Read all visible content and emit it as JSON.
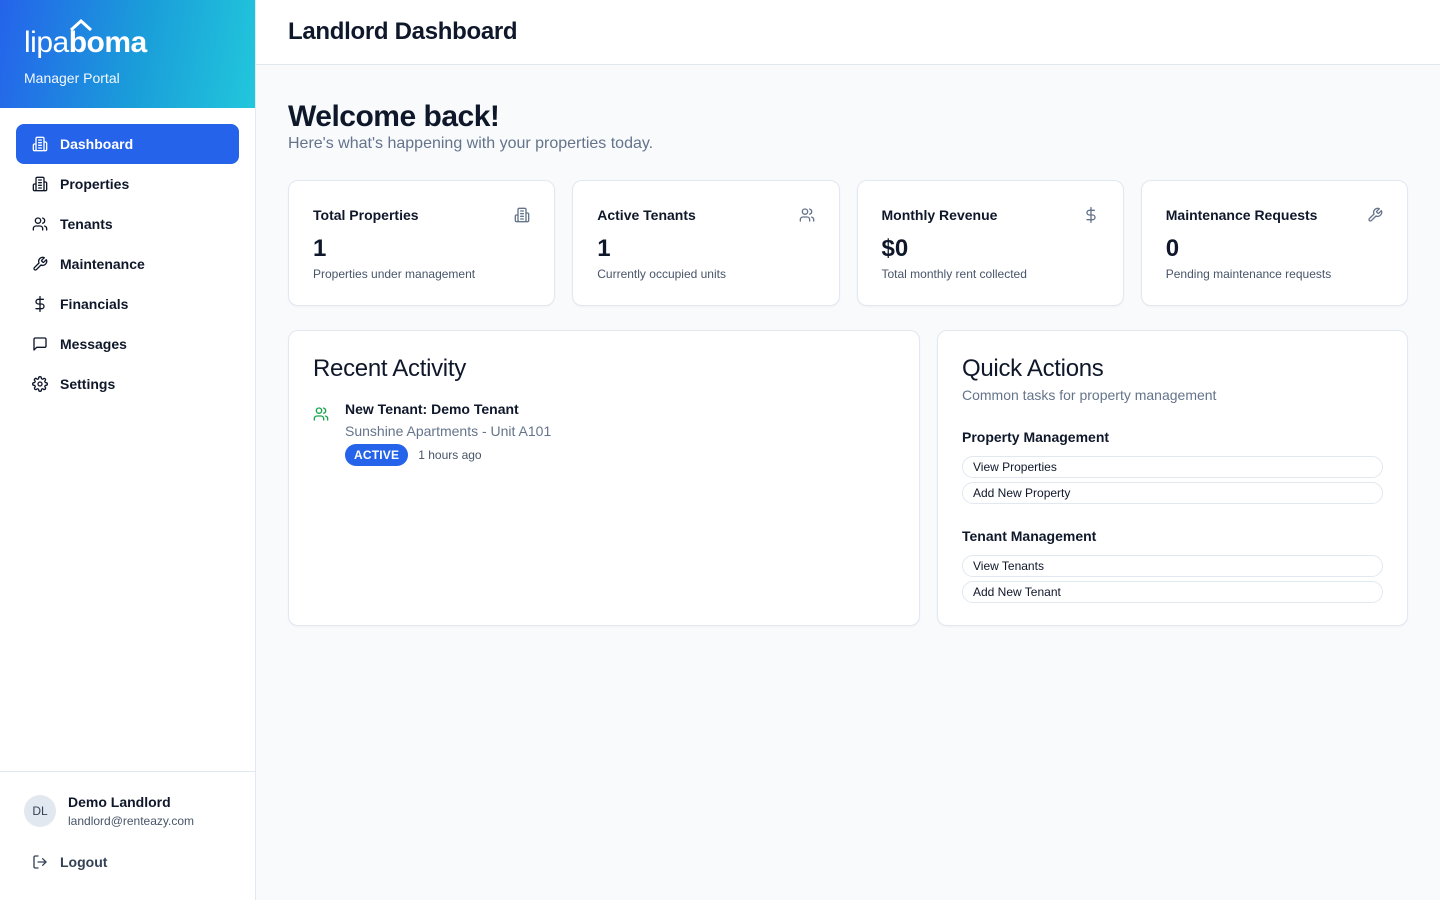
{
  "brand": {
    "logo_light": "lipa",
    "logo_bold": "boma",
    "subtitle": "Manager Portal"
  },
  "colors": {
    "primary": "#2563eb",
    "gradient_start": "#2563eb",
    "gradient_end": "#22c7dc",
    "success_icon": "#16a34a"
  },
  "sidebar": {
    "items": [
      {
        "label": "Dashboard",
        "icon": "building-icon",
        "active": true
      },
      {
        "label": "Properties",
        "icon": "building-icon"
      },
      {
        "label": "Tenants",
        "icon": "users-icon"
      },
      {
        "label": "Maintenance",
        "icon": "wrench-icon"
      },
      {
        "label": "Financials",
        "icon": "dollar-icon"
      },
      {
        "label": "Messages",
        "icon": "message-icon"
      },
      {
        "label": "Settings",
        "icon": "gear-icon"
      }
    ],
    "user": {
      "initials": "DL",
      "name": "Demo Landlord",
      "email": "landlord@renteazy.com"
    },
    "logout_label": "Logout"
  },
  "header": {
    "title": "Landlord Dashboard"
  },
  "welcome": {
    "title": "Welcome back!",
    "subtitle": "Here's what's happening with your properties today."
  },
  "stats": [
    {
      "title": "Total Properties",
      "value": "1",
      "desc": "Properties under management",
      "icon": "building-icon"
    },
    {
      "title": "Active Tenants",
      "value": "1",
      "desc": "Currently occupied units",
      "icon": "users-icon"
    },
    {
      "title": "Monthly Revenue",
      "value": "$0",
      "desc": "Total monthly rent collected",
      "icon": "dollar-icon"
    },
    {
      "title": "Maintenance Requests",
      "value": "0",
      "desc": "Pending maintenance requests",
      "icon": "wrench-icon"
    }
  ],
  "activity": {
    "title": "Recent Activity",
    "items": [
      {
        "title": "New Tenant: Demo Tenant",
        "subtitle": "Sunshine Apartments - Unit A101",
        "badge": "ACTIVE",
        "time": "1 hours ago",
        "icon": "users-icon"
      }
    ]
  },
  "quick_actions": {
    "title": "Quick Actions",
    "subtitle": "Common tasks for property management",
    "groups": [
      {
        "title": "Property Management",
        "buttons": [
          "View Properties",
          "Add New Property"
        ]
      },
      {
        "title": "Tenant Management",
        "buttons": [
          "View Tenants",
          "Add New Tenant"
        ]
      }
    ]
  }
}
